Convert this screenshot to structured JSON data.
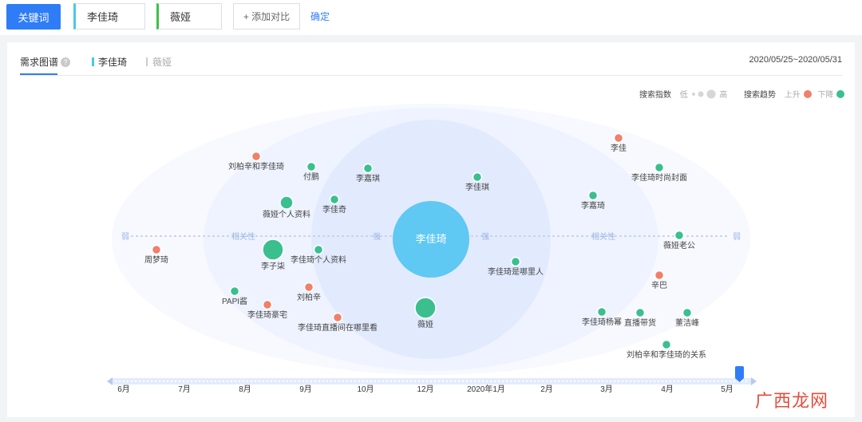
{
  "topbar": {
    "keyword_button": "关键词",
    "keyword1": "李佳琦",
    "keyword2": "薇娅",
    "add_compare": "+ 添加对比",
    "confirm": "确定"
  },
  "tabs": {
    "demand_graph": "需求图谱",
    "help": "?",
    "kw1": "李佳琦",
    "kw2": "薇娅",
    "date_range": "2020/05/25~2020/05/31"
  },
  "legend": {
    "search_index": "搜索指数",
    "low": "低",
    "high": "高",
    "search_trend": "搜索趋势",
    "up": "上升",
    "down": "下降",
    "up_color": "#f0806a",
    "down_color": "#3bbf8f"
  },
  "graph": {
    "center": "李佳琦",
    "axis_weak": "弱",
    "axis_relevance": "相关性",
    "axis_strong": "强",
    "nodes": [
      {
        "label": "刘柏辛和李佳琦",
        "trend": "up",
        "size": "s"
      },
      {
        "label": "付鹏",
        "trend": "down",
        "size": "s"
      },
      {
        "label": "李嘉琪",
        "trend": "down",
        "size": "s"
      },
      {
        "label": "李佳琪",
        "trend": "down",
        "size": "s"
      },
      {
        "label": "李佳",
        "trend": "up",
        "size": "s"
      },
      {
        "label": "李佳琦时尚封面",
        "trend": "down",
        "size": "s"
      },
      {
        "label": "薇娅个人资料",
        "trend": "down",
        "size": "m"
      },
      {
        "label": "李佳奇",
        "trend": "down",
        "size": "s"
      },
      {
        "label": "李嘉琦",
        "trend": "down",
        "size": "s"
      },
      {
        "label": "周梦琦",
        "trend": "up",
        "size": "s"
      },
      {
        "label": "李子柒",
        "trend": "down",
        "size": "l"
      },
      {
        "label": "李佳琦个人资料",
        "trend": "down",
        "size": "s"
      },
      {
        "label": "李佳琦是哪里人",
        "trend": "down",
        "size": "s"
      },
      {
        "label": "薇娅老公",
        "trend": "down",
        "size": "s"
      },
      {
        "label": "PAPI酱",
        "trend": "down",
        "size": "s"
      },
      {
        "label": "刘柏辛",
        "trend": "up",
        "size": "s"
      },
      {
        "label": "李佳琦豪宅",
        "trend": "up",
        "size": "s"
      },
      {
        "label": "李佳琦直播间在哪里看",
        "trend": "up",
        "size": "s"
      },
      {
        "label": "薇娅",
        "trend": "down",
        "size": "l"
      },
      {
        "label": "辛巴",
        "trend": "up",
        "size": "s"
      },
      {
        "label": "李佳琦杨幂",
        "trend": "down",
        "size": "s"
      },
      {
        "label": "直播带货",
        "trend": "down",
        "size": "s"
      },
      {
        "label": "董洁峰",
        "trend": "down",
        "size": "s"
      },
      {
        "label": "刘柏辛和李佳琦的关系",
        "trend": "down",
        "size": "s"
      }
    ]
  },
  "timeline": {
    "months": [
      "6月",
      "7月",
      "8月",
      "9月",
      "10月",
      "12月",
      "2020年1月",
      "2月",
      "3月",
      "4月",
      "5月"
    ]
  },
  "watermark": "广西龙网"
}
